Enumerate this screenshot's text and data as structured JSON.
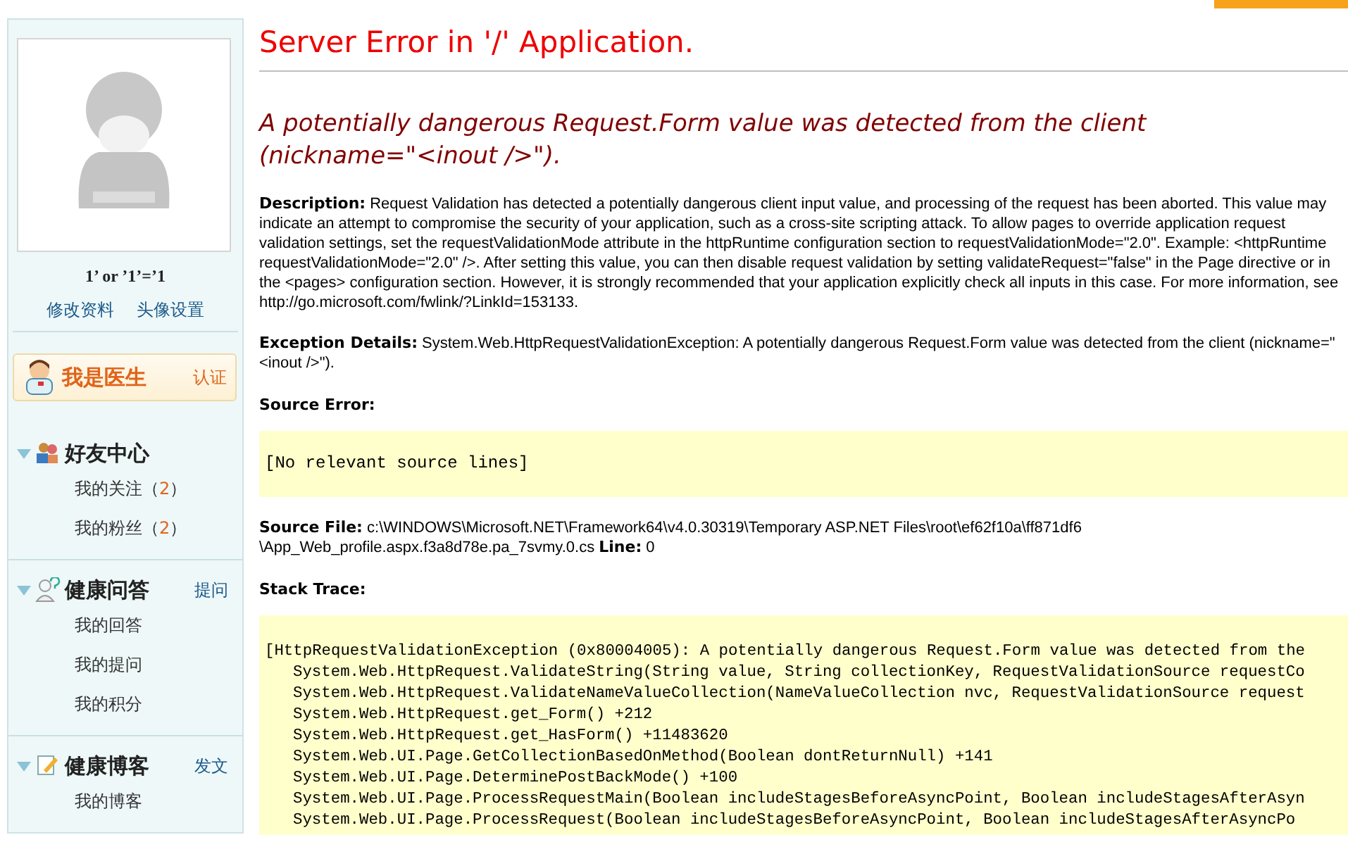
{
  "sidebar": {
    "username": "1’ or ’1’=’1",
    "profile_links": [
      "修改资料",
      "头像设置"
    ],
    "doctor_box": {
      "title": "我是医生",
      "action": "认证"
    },
    "sections": [
      {
        "title": "好友中心",
        "expanded": true,
        "items": [
          {
            "label": "我的关注",
            "count": "2",
            "brackets": [
              "（",
              "）"
            ]
          },
          {
            "label": "我的粉丝",
            "count": "2",
            "brackets": [
              "（",
              "）"
            ]
          }
        ]
      },
      {
        "title": "健康问答",
        "expanded": true,
        "action": "提问",
        "items": [
          {
            "label": "我的回答"
          },
          {
            "label": "我的提问"
          },
          {
            "label": "我的积分"
          }
        ]
      },
      {
        "title": "健康博客",
        "expanded": true,
        "action": "发文",
        "items": [
          {
            "label": "我的博客"
          }
        ]
      }
    ]
  },
  "error_page": {
    "title": "Server Error in '/' Application.",
    "message": "A potentially dangerous Request.Form value was detected from the client (nickname=\"<inout />\").",
    "description": {
      "label": "Description:",
      "text": "Request Validation has detected a potentially dangerous client input value, and processing of the request has been aborted. This value may indicate an attempt to compromise the security of your application, such as a cross-site scripting attack. To allow pages to override application request validation settings, set the requestValidationMode attribute in the httpRuntime configuration section to requestValidationMode=\"2.0\". Example: <httpRuntime requestValidationMode=\"2.0\" />. After setting this value, you can then disable request validation by setting validateRequest=\"false\" in the Page directive or in the <pages> configuration section. However, it is strongly recommended that your application explicitly check all inputs in this case. For more information, see http://go.microsoft.com/fwlink/?LinkId=153133."
    },
    "exception_details": {
      "label": "Exception Details:",
      "text": "System.Web.HttpRequestValidationException: A potentially dangerous Request.Form value was detected from the client (nickname=\"<inout />\")."
    },
    "source_error": {
      "label": "Source Error:",
      "code": "[No relevant source lines]"
    },
    "source_file": {
      "label": "Source File:",
      "path": "c:\\WINDOWS\\Microsoft.NET\\Framework64\\v4.0.30319\\Temporary ASP.NET Files\\root\\ef62f10a\\ff871df6 \\App_Web_profile.aspx.f3a8d78e.pa_7svmy.0.cs",
      "line_label": "Line:",
      "line": "0"
    },
    "stack_trace": {
      "label": "Stack Trace:",
      "lines": [
        {
          "kind": "header",
          "text": "[HttpRequestValidationException (0x80004005): A potentially dangerous Request.Form value was detected from the"
        },
        {
          "kind": "frame",
          "text": "System.Web.HttpRequest.ValidateString(String value, String collectionKey, RequestValidationSource requestCo"
        },
        {
          "kind": "frame",
          "text": "System.Web.HttpRequest.ValidateNameValueCollection(NameValueCollection nvc, RequestValidationSource request"
        },
        {
          "kind": "frame",
          "text": "System.Web.HttpRequest.get_Form() +212"
        },
        {
          "kind": "frame",
          "text": "System.Web.HttpRequest.get_HasForm() +11483620"
        },
        {
          "kind": "frame",
          "text": "System.Web.UI.Page.GetCollectionBasedOnMethod(Boolean dontReturnNull) +141"
        },
        {
          "kind": "frame",
          "text": "System.Web.UI.Page.DeterminePostBackMode() +100"
        },
        {
          "kind": "frame",
          "text": "System.Web.UI.Page.ProcessRequestMain(Boolean includeStagesBeforeAsyncPoint, Boolean includeStagesAfterAsyn"
        },
        {
          "kind": "frame",
          "text": "System.Web.UI.Page.ProcessRequest(Boolean includeStagesBeforeAsyncPoint, Boolean includeStagesAfterAsyncPo"
        }
      ]
    }
  }
}
